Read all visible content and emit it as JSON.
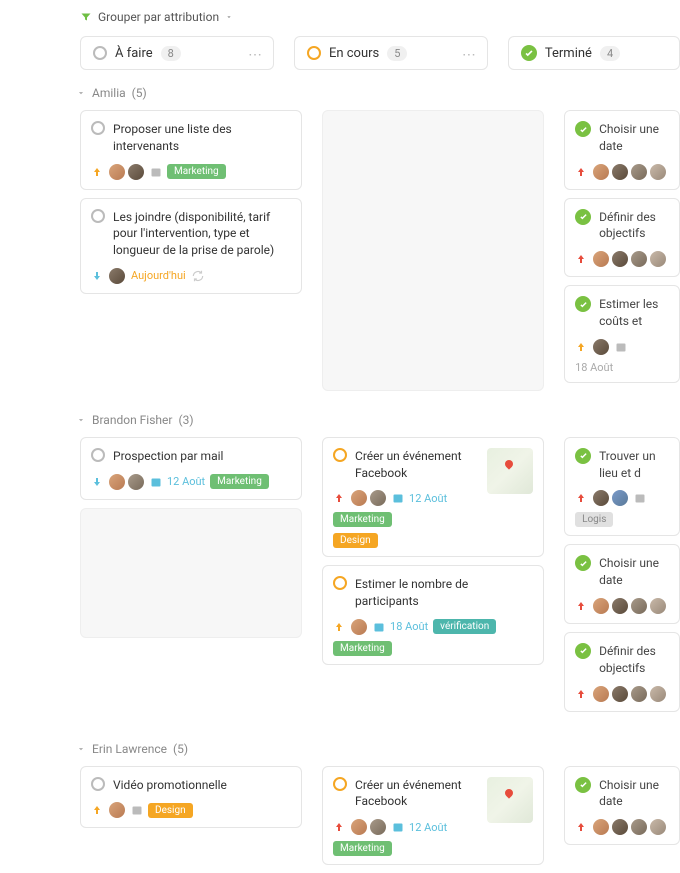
{
  "groupBy": "Grouper par attribution",
  "columns": [
    {
      "title": "À faire",
      "count": "8"
    },
    {
      "title": "En cours",
      "count": "5"
    },
    {
      "title": "Terminé",
      "count": "4"
    }
  ],
  "lanes": [
    {
      "name": "Amilia",
      "count": "(5)"
    },
    {
      "name": "Brandon Fisher",
      "count": "(3)"
    },
    {
      "name": "Erin Lawrence",
      "count": "(5)"
    }
  ],
  "cards": {
    "amilia_todo_1": {
      "title": "Proposer une liste des intervenants",
      "tag": "Marketing"
    },
    "amilia_todo_2": {
      "title": "Les joindre (disponibilité, tarif pour l'intervention, type et longueur de la prise de parole)",
      "date": "Aujourd'hui"
    },
    "amilia_done_1": {
      "title": "Choisir une date"
    },
    "amilia_done_2": {
      "title": "Définir des objectifs"
    },
    "amilia_done_3": {
      "title": "Estimer les coûts et",
      "date": "18 Août"
    },
    "brandon_todo_1": {
      "title": "Prospection par mail",
      "date": "12 Août",
      "tag": "Marketing"
    },
    "brandon_prog_1": {
      "title": "Créer un événement Facebook",
      "date": "12 Août",
      "tag1": "Marketing",
      "tag2": "Design"
    },
    "brandon_prog_2": {
      "title": "Estimer le nombre de participants",
      "date": "18 Août",
      "tag1": "vérification",
      "tag2": "Marketing"
    },
    "brandon_done_1": {
      "title": "Trouver un lieu et d",
      "tag": "Logis"
    },
    "brandon_done_2": {
      "title": "Choisir une date"
    },
    "brandon_done_3": {
      "title": "Définir des objectifs"
    },
    "erin_todo_1": {
      "title": "Vidéo promotionnelle",
      "tag": "Design"
    },
    "erin_prog_1": {
      "title": "Créer un événement Facebook",
      "date": "12 Août",
      "tag": "Marketing"
    },
    "erin_done_1": {
      "title": "Choisir une date"
    }
  }
}
